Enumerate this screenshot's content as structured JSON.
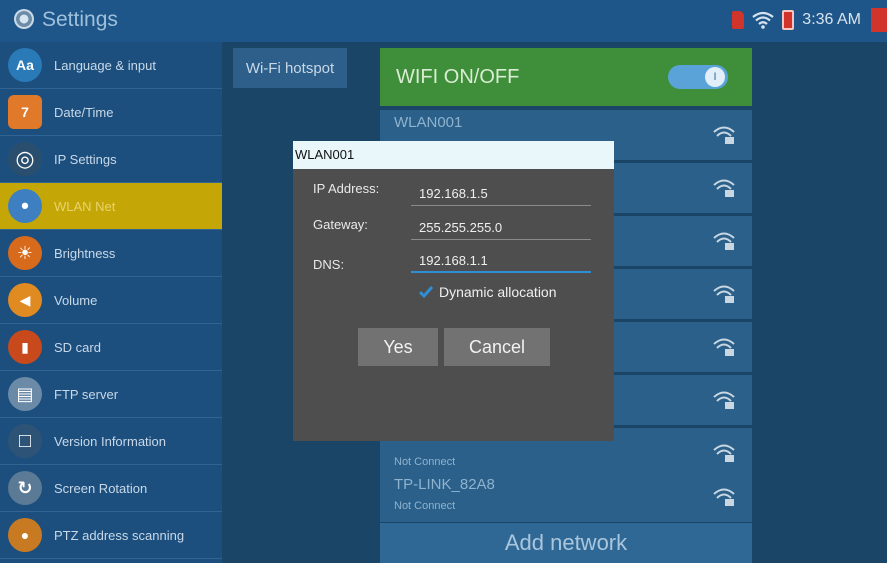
{
  "status_bar": {
    "title": "Settings",
    "time": "3:36 AM"
  },
  "sidebar": {
    "items": [
      {
        "label": "Language & input",
        "icon": "language-icon",
        "icon_text": "Aa",
        "color": "#2a7ab8"
      },
      {
        "label": "Date/Time",
        "icon": "calendar-icon",
        "icon_text": "7",
        "color": "#e07a2a"
      },
      {
        "label": "IP Settings",
        "icon": "globe-icon",
        "icon_text": "◎",
        "color": "#2a4f6e"
      },
      {
        "label": "WLAN Net",
        "icon": "wlan-icon",
        "icon_text": "•",
        "color": "#3d7fc0"
      },
      {
        "label": "Brightness",
        "icon": "brightness-icon",
        "icon_text": "☀",
        "color": "#d86a1c"
      },
      {
        "label": "Volume",
        "icon": "volume-icon",
        "icon_text": "◀",
        "color": "#e08a22"
      },
      {
        "label": "SD card",
        "icon": "sd-card-icon",
        "icon_text": "▮",
        "color": "#c84a1c"
      },
      {
        "label": "FTP server",
        "icon": "ftp-icon",
        "icon_text": "▤",
        "color": "#6a8aa8"
      },
      {
        "label": "Version Information",
        "icon": "info-icon",
        "icon_text": "□",
        "color": "#2d5476"
      },
      {
        "label": "Screen Rotation",
        "icon": "rotation-icon",
        "icon_text": "↻",
        "color": "#5a7a96"
      },
      {
        "label": "PTZ address scanning",
        "icon": "ptz-icon",
        "icon_text": "●",
        "color": "#c87a22"
      }
    ],
    "active_index": 3
  },
  "main": {
    "hotspot_tab": "Wi-Fi hotspot",
    "wifi_toggle": {
      "label": "WIFI ON/OFF",
      "state": "on",
      "knob_text": "I"
    },
    "networks": [
      {
        "name": "WLAN001",
        "status": ""
      },
      {
        "name": "",
        "status": ""
      },
      {
        "name": "",
        "status": ""
      },
      {
        "name": "",
        "status": ""
      },
      {
        "name": "",
        "status": ""
      },
      {
        "name": "",
        "status": ""
      },
      {
        "name": "",
        "status": "Not Connect"
      },
      {
        "name": "TP-LINK_82A8",
        "status": "Not Connect"
      }
    ],
    "add_network": "Add network"
  },
  "dialog": {
    "title": "WLAN001",
    "ip_label": "IP Address:",
    "ip_value": "192.168.1.5",
    "gateway_label": "Gateway:",
    "gateway_value": "255.255.255.0",
    "dns_label": "DNS:",
    "dns_value": "192.168.1.1",
    "dynamic_label": "Dynamic allocation",
    "dynamic_checked": true,
    "yes_label": "Yes",
    "cancel_label": "Cancel"
  },
  "colors": {
    "accent": "#2f8fd4",
    "active_item": "#c4a706",
    "toggle_on": "#3f8e39"
  }
}
